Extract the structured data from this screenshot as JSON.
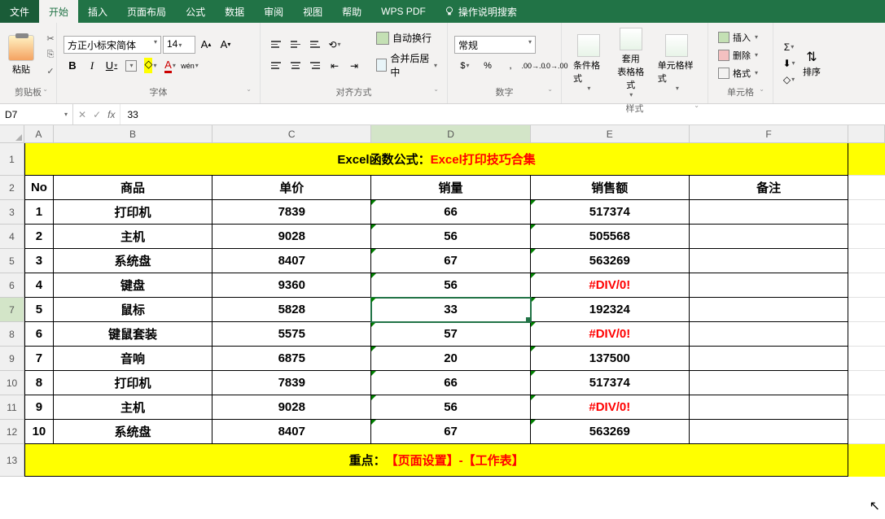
{
  "tabs": {
    "file": "文件",
    "home": "开始",
    "insert": "插入",
    "layout": "页面布局",
    "formula": "公式",
    "data": "数据",
    "review": "审阅",
    "view": "视图",
    "help": "帮助",
    "wps": "WPS PDF",
    "search": "操作说明搜索"
  },
  "ribbon": {
    "clipboard": {
      "label": "剪贴板",
      "paste": "粘贴"
    },
    "font": {
      "label": "字体",
      "name": "方正小标宋简体",
      "size": "14"
    },
    "alignment": {
      "label": "对齐方式",
      "wrap": "自动换行",
      "merge": "合并后居中"
    },
    "number": {
      "label": "数字",
      "format": "常规"
    },
    "styles": {
      "label": "样式",
      "conditional": "条件格式",
      "table": "套用\n表格格式",
      "cell": "单元格样式"
    },
    "cells": {
      "label": "单元格",
      "insert": "插入",
      "delete": "删除",
      "format": "格式"
    },
    "editing": {
      "sort": "排序"
    }
  },
  "namebox": "D7",
  "formula_value": "33",
  "columns": [
    "A",
    "B",
    "C",
    "D",
    "E",
    "F"
  ],
  "title": {
    "black": "Excel函数公式：",
    "red": "Excel打印技巧合集"
  },
  "headers": [
    "No",
    "商品",
    "单价",
    "销量",
    "销售额",
    "备注"
  ],
  "rows": [
    {
      "no": "1",
      "name": "打印机",
      "price": "7839",
      "qty": "66",
      "amount": "517374",
      "err": false
    },
    {
      "no": "2",
      "name": "主机",
      "price": "9028",
      "qty": "56",
      "amount": "505568",
      "err": false
    },
    {
      "no": "3",
      "name": "系统盘",
      "price": "8407",
      "qty": "67",
      "amount": "563269",
      "err": false
    },
    {
      "no": "4",
      "name": "键盘",
      "price": "9360",
      "qty": "56",
      "amount": "#DIV/0!",
      "err": true
    },
    {
      "no": "5",
      "name": "鼠标",
      "price": "5828",
      "qty": "33",
      "amount": "192324",
      "err": false
    },
    {
      "no": "6",
      "name": "键鼠套装",
      "price": "5575",
      "qty": "57",
      "amount": "#DIV/0!",
      "err": true
    },
    {
      "no": "7",
      "name": "音响",
      "price": "6875",
      "qty": "20",
      "amount": "137500",
      "err": false
    },
    {
      "no": "8",
      "name": "打印机",
      "price": "7839",
      "qty": "66",
      "amount": "517374",
      "err": false
    },
    {
      "no": "9",
      "name": "主机",
      "price": "9028",
      "qty": "56",
      "amount": "#DIV/0!",
      "err": true
    },
    {
      "no": "10",
      "name": "系统盘",
      "price": "8407",
      "qty": "67",
      "amount": "563269",
      "err": false
    }
  ],
  "footer": {
    "black": "重点：",
    "red": "【页面设置】-【工作表】"
  },
  "selected_row_index": 4
}
